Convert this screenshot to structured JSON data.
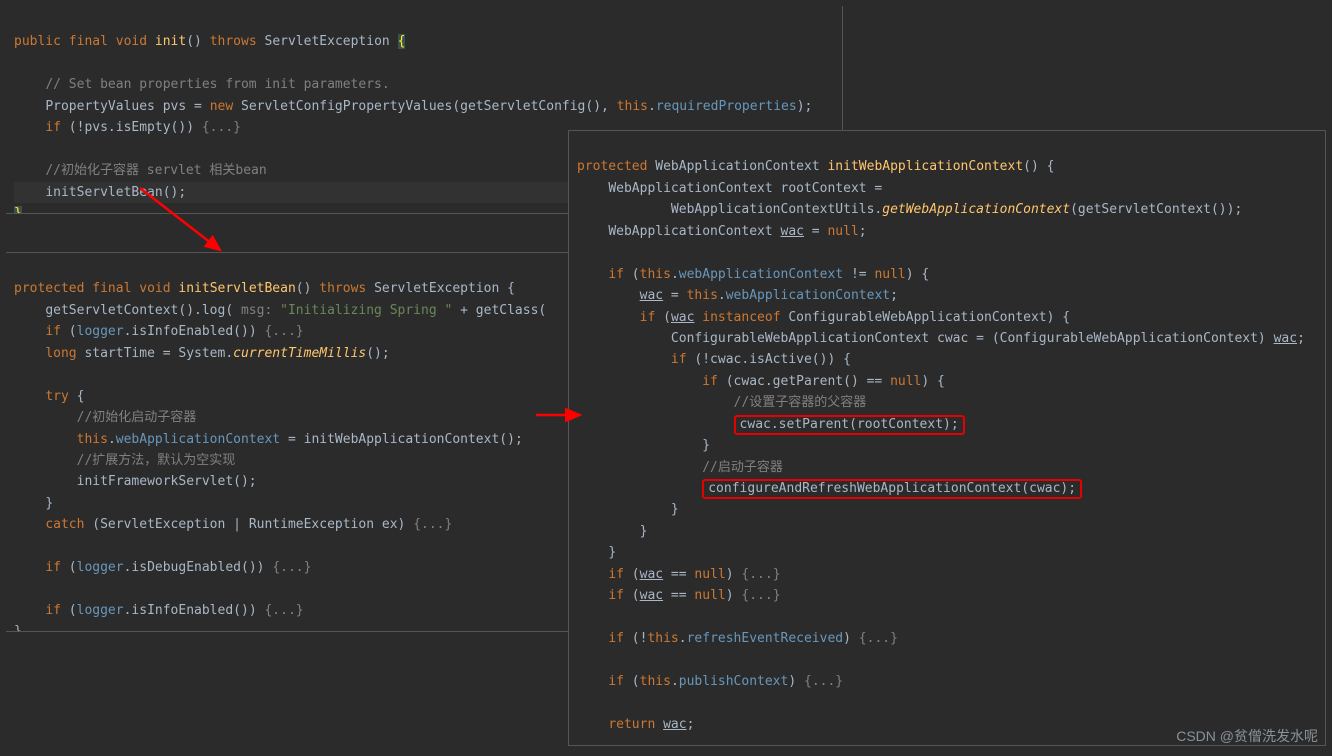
{
  "watermark": "CSDN @贫僧洗发水呢",
  "panel1": {
    "sig": {
      "kw_public": "public",
      "kw_final": "final",
      "kw_void": "void",
      "fn": "init",
      "paren": "()",
      "kw_throws": "throws",
      "ex": "ServletException",
      "brace": "{"
    },
    "comment1": "// Set bean properties from init parameters.",
    "l2": {
      "a": "PropertyValues pvs = ",
      "kw_new": "new",
      "b": " ServletConfigPropertyValues(getServletConfig(), ",
      "kw_this": "this",
      "c": ".",
      "prop": "requiredProperties",
      "d": ");"
    },
    "l3": {
      "kw_if": "if",
      "a": " (!pvs.isEmpty()) ",
      "fold": "{...}"
    },
    "comment2": "//初始化子容器 servlet 相关bean",
    "l5": "initServletBean();",
    "close": "}"
  },
  "panel2": {
    "sig": {
      "kw_protected": "protected",
      "kw_final": "final",
      "kw_void": "void",
      "fn": "initServletBean",
      "paren": "()",
      "kw_throws": "throws",
      "ex": "ServletException",
      "brace": "{"
    },
    "l1": {
      "a": "getServletContext().log(",
      "param": " msg: ",
      "str": "\"Initializing Spring \"",
      "b": " + getClass("
    },
    "l2": {
      "kw_if": "if",
      "a": " (",
      "logger": "logger",
      "b": ".isInfoEnabled()) ",
      "fold": "{...}"
    },
    "l3": {
      "kw_long": "long",
      "a": " startTime = System.",
      "fn": "currentTimeMillis",
      "b": "();"
    },
    "l4": {
      "kw_try": "try",
      "brace": " {"
    },
    "comment1": "//初始化启动子容器",
    "l5": {
      "kw_this": "this",
      "a": ".",
      "prop": "webApplicationContext",
      "b": " = initWebApplicationContext();"
    },
    "comment2": "//扩展方法，默认为空实现",
    "l6": "initFrameworkServlet();",
    "close1": "}",
    "l7": {
      "kw_catch": "catch",
      "a": " (ServletException | RuntimeException ex) ",
      "fold": "{...}"
    },
    "l8": {
      "kw_if": "if",
      "a": " (",
      "logger": "logger",
      "b": ".isDebugEnabled()) ",
      "fold": "{...}"
    },
    "l9": {
      "kw_if": "if",
      "a": " (",
      "logger": "logger",
      "b": ".isInfoEnabled()) ",
      "fold": "{...}"
    },
    "close2": "}"
  },
  "panel3": {
    "sig": {
      "kw_protected": "protected",
      "ret": "WebApplicationContext",
      "fn": "initWebApplicationContext",
      "paren": "()",
      "brace": " {"
    },
    "l1": "WebApplicationContext rootContext =",
    "l2": {
      "a": "WebApplicationContextUtils.",
      "fn": "getWebApplicationContext",
      "b": "(getServletContext());"
    },
    "l3": {
      "a": "WebApplicationContext ",
      "wac": "wac",
      "b": " = ",
      "kw_null": "null",
      "c": ";"
    },
    "l4": {
      "kw_if": "if",
      "a": " (",
      "kw_this": "this",
      "b": ".",
      "prop": "webApplicationContext",
      "c": " != ",
      "kw_null": "null",
      "d": ") {"
    },
    "l5": {
      "wac": "wac",
      "a": " = ",
      "kw_this": "this",
      "b": ".",
      "prop": "webApplicationContext",
      "c": ";"
    },
    "l6": {
      "kw_if": "if",
      "a": " (",
      "wac": "wac",
      "b": " ",
      "kw_instanceof": "instanceof",
      "c": " ConfigurableWebApplicationContext) {"
    },
    "l7": {
      "a": "ConfigurableWebApplicationContext cwac = (ConfigurableWebApplicationContext) ",
      "wac": "wac",
      "b": ";"
    },
    "l8": {
      "kw_if": "if",
      "a": " (!cwac.isActive()) {"
    },
    "l9": {
      "kw_if": "if",
      "a": " (cwac.getParent() == ",
      "kw_null": "null",
      "b": ") {"
    },
    "comment1": "//设置子容器的父容器",
    "l10": "cwac.setParent(rootContext);",
    "close_a": "}",
    "comment2": "//启动子容器",
    "l11": "configureAndRefreshWebApplicationContext(cwac);",
    "close_b": "}",
    "close_c": "}",
    "close_d": "}",
    "l12": {
      "kw_if": "if",
      "a": " (",
      "wac": "wac",
      "b": " == ",
      "kw_null": "null",
      "c": ") ",
      "fold": "{...}"
    },
    "l13": {
      "kw_if": "if",
      "a": " (",
      "wac": "wac",
      "b": " == ",
      "kw_null": "null",
      "c": ") ",
      "fold": "{...}"
    },
    "l14": {
      "kw_if": "if",
      "a": " (!",
      "kw_this": "this",
      "b": ".",
      "prop": "refreshEventReceived",
      "c": ") ",
      "fold": "{...}"
    },
    "l15": {
      "kw_if": "if",
      "a": " (",
      "kw_this": "this",
      "b": ".",
      "prop": "publishContext",
      "c": ") ",
      "fold": "{...}"
    },
    "ret": {
      "kw_return": "return",
      "sp": " ",
      "wac": "wac",
      "c": ";"
    }
  }
}
